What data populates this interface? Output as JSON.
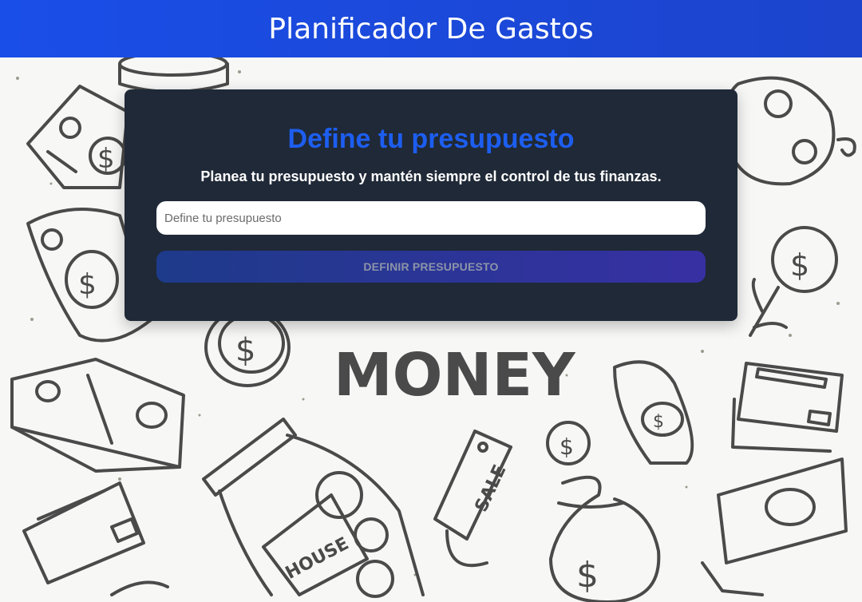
{
  "header": {
    "title": "Planificador De Gastos"
  },
  "budget_form": {
    "heading": "Define tu presupuesto",
    "subtitle": "Planea tu presupuesto y mantén siempre el control de tus finanzas.",
    "input_placeholder": "Define tu presupuesto",
    "input_value": "",
    "submit_label": "DEFINIR PRESUPUESTO"
  },
  "background": {
    "word": "MONEY",
    "tag_label": "SALE",
    "jar_label": "HOUSE",
    "currency_symbol": "$"
  },
  "colors": {
    "header_bg": "#1a4ee8",
    "card_bg": "#1f2937",
    "heading": "#1d5ef0",
    "button_from": "#1e3a8a",
    "button_to": "#3730a3"
  }
}
